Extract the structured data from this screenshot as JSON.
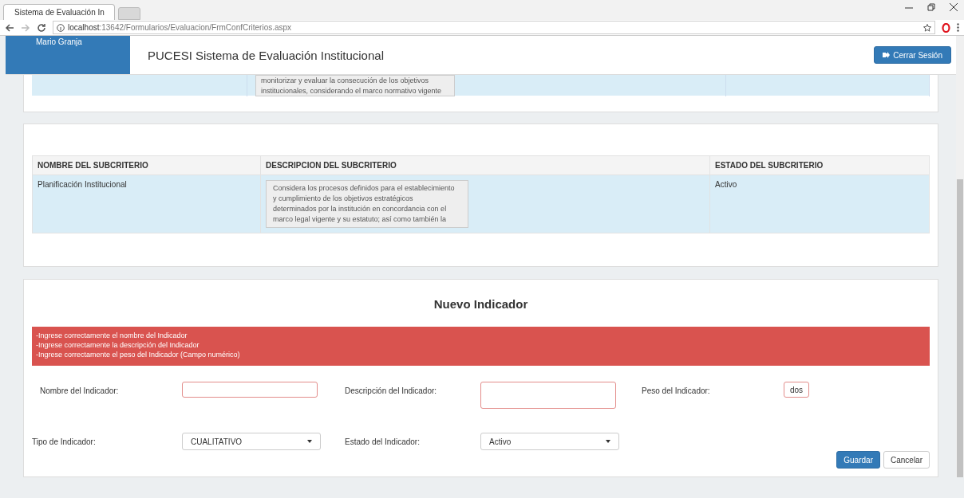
{
  "browser": {
    "tab_title": "Sistema de Evaluación In",
    "url_host": "localhost",
    "url_path": ":13642/Formularios/Evaluacion/FrmConfCriterios.aspx"
  },
  "header": {
    "user": "Mario Granja",
    "title": "PUCESI Sistema de Evaluación Institucional",
    "logout": "Cerrar Sesión"
  },
  "previous_row": {
    "description_lines": [
      "monitorizar y evaluar la consecución de los objetivos",
      "institucionales, considerando el marco normativo vigente"
    ]
  },
  "subcriteria_table": {
    "columns": [
      "NOMBRE DEL SUBCRITERIO",
      "DESCRIPCION DEL SUBCRITERIO",
      "ESTADO DEL SUBCRITERIO"
    ],
    "rows": [
      {
        "name": "Planificación Institucional",
        "description_lines": [
          "Considera los procesos definidos para el establecimiento",
          "y cumplimiento de los objetivos estratégicos",
          "determinados por la institución en concordancia con el",
          "marco legal vigente y su estatuto; así como también la"
        ],
        "status": "Activo",
        "selected": true
      }
    ]
  },
  "form": {
    "title": "Nuevo Indicador",
    "errors": [
      "-Ingrese correctamente el nombre del Indicador",
      "-Ingrese correctamente la descripción del Indicador",
      "-Ingrese correctamente el peso del Indicador (Campo numérico)"
    ],
    "fields": [
      {
        "kind": "text",
        "label": "Nombre del Indicador:",
        "invalid": true
      },
      {
        "kind": "textarea",
        "label": "Descripción del Indicador:",
        "invalid": true
      },
      {
        "kind": "short",
        "label": "Peso del Indicador:",
        "value": "dos",
        "invalid": true
      },
      {
        "kind": "select",
        "label": "Tipo de Indicador:",
        "value": "CUALITATIVO",
        "invalid": false
      },
      {
        "kind": "select",
        "label": "Estado del Indicador:",
        "value": "Activo",
        "invalid": false
      }
    ],
    "buttons": [
      {
        "label": "Guardar",
        "kind": "primary"
      },
      {
        "label": "Cancelar",
        "kind": "default"
      }
    ]
  }
}
